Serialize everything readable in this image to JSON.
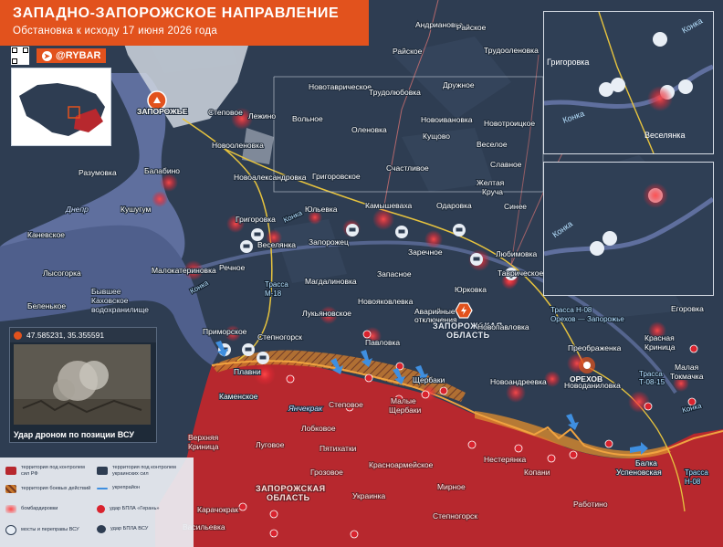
{
  "header": {
    "title": "ЗАПАДНО-ЗАПОРОЖСКОЕ НАПРАВЛЕНИЕ",
    "subtitle": "Обстановка к исходу 17 июня 2026 года",
    "brand": "@RYBAR"
  },
  "colors": {
    "russian_control": "#b7282e",
    "ukrainian_control": "#2e3d52",
    "combat_zone": "#d8892e",
    "accent": "#e2521d",
    "water": "#5f6f9e"
  },
  "towns": {
    "andrianovka": "Андриановка",
    "rayskoe": "Райское",
    "rayskoe2": "Райское",
    "trudooleny": "Трудооленовка",
    "druzhnoe": "Дружное",
    "novotavricheskoe": "Новотаврическое",
    "trudolyubovka": "Трудолюбовка",
    "vol": "Вольное",
    "olenovka": "Оленовка",
    "novoivanovka": "Новоивановка",
    "novotroitskoe": "Новотроицкое",
    "kushchovo": "Кущово",
    "veseloe": "Веселое",
    "slavnoe": "Славное",
    "schastlivoe": "Счастливое",
    "zheltaya": "Желтая",
    "krucha": "Круча",
    "stepovoe1": "Степовое",
    "lezhino": "Лежино",
    "novoolenovka": "Новооленовка",
    "novoaleksandrovka": "Новоалександровка",
    "grigorovskoe": "Григоровское",
    "zaporozhye": "ЗАПОРОЖЬЕ",
    "balabino": "Балабино",
    "razumovka": "Разумовка",
    "kushugum": "Кушугум",
    "dnepr": "Днепр",
    "kanevskoe": "Каневское",
    "lysogorka": "Лысогорка",
    "belenkoe": "Беленькое",
    "yulevka": "Юльевка",
    "kamyshevaha": "Камышеваха",
    "odarovka": "Одаровка",
    "sinee": "Синее",
    "grigorovka": "Григоровка",
    "konka1": "Конка",
    "vesselyanka": "Веселянка",
    "zaporozhets": "Запорожец",
    "zarechnoe": "Заречное",
    "lyubimovka": "Любимовка",
    "malokaterinovka": "Малокатериновка",
    "rechnoe": "Речное",
    "magdalinovka": "Магдалиновка",
    "zapasnoe": "Запасное",
    "yurkovka": "Юрковка",
    "tavricheskoe": "Таврическое",
    "konka2": "Конка",
    "reservoir1": "Бывшее",
    "reservoir2": "Каховское",
    "reservoir3": "водохранилище",
    "lukyanovskoe": "Лукьяновское",
    "novoyakovlevka": "Новояковлевка",
    "avar1": "Аварийные",
    "avar2": "отключения",
    "zap_obl1": "ЗАПОРОЖСКАЯ",
    "zap_obl2": "ОБЛАСТЬ",
    "novopavlovka": "Новопавловка",
    "egorovka": "Егоровка",
    "primorskoe": "Приморское",
    "stepnogorsk": "Степногорск",
    "pavlovka": "Павловка",
    "preobrazhenka": "Преображенка",
    "krasnaya1": "Красная",
    "krasnaya2": "Криница",
    "plavni": "Плавни",
    "shcherbaki": "Щербаки",
    "novoandreevka": "Новоандреевка",
    "orekhov": "ОРЕХОВ",
    "malaya1": "Малая",
    "malaya2": "Токмачка",
    "kamenskoe": "Каменское",
    "yanchekrak": "Янчекрак",
    "stepovoe2": "Степовое",
    "malye1": "Малые",
    "malye2": "Щербаки",
    "novodanilovka": "Новоданиловка",
    "konka3": "Конка",
    "lobkovoe": "Лобковое",
    "verkhnyaya1": "Верхняя",
    "verkhnyaya2": "Криница",
    "lugovoe": "Луговое",
    "pyatikhatki": "Пятихатки",
    "nesterianka": "Нестерянка",
    "balka1": "Балка",
    "balka2": "Успеновская",
    "grozovoe": "Грозовое",
    "krasnoarmeyskoe": "Красноармейское",
    "kopani": "Копани",
    "zap_obl3": "ЗАПОРОЖСКАЯ",
    "zap_obl4": "ОБЛАСТЬ",
    "mirnoe": "Мирное",
    "rabotino": "Работино",
    "karachokrak": "Карачокрак",
    "vasilevka": "Васильевка",
    "ukrainka": "Украинка",
    "stepnogorsk2": "Степногорск"
  },
  "roads": {
    "m18_a": "Трасса",
    "m18_b": "М-18",
    "h08_a": "Трасса Н-08",
    "h08_b": "Орехов — Запорожье",
    "t0815_a": "Трасса",
    "t0815_b": "Т-08-15",
    "h08s_a": "Трасса",
    "h08s_b": "Н-08"
  },
  "zoom_top": {
    "grigorovka": "Григоровка",
    "konka": "Конка",
    "vesselyanka": "Веселянка",
    "konka2": "Конка"
  },
  "zoom_bottom": {
    "konka": "Конка"
  },
  "photo": {
    "coords": "47.585231, 35.355591",
    "caption": "Удар дроном по позиции ВСУ"
  },
  "legend": {
    "ru_control": "территория под контролем сил РФ",
    "ua_control": "территория под контролем украинских сил",
    "combat": "территория боевых действий",
    "fortifications": "укрепрайон",
    "bombardment": "бомбардировки",
    "geran": "удар БПЛА «Герань»",
    "bridges": "мосты и переправы ВСУ",
    "drone_strike": "удар БПЛА ВСУ"
  }
}
